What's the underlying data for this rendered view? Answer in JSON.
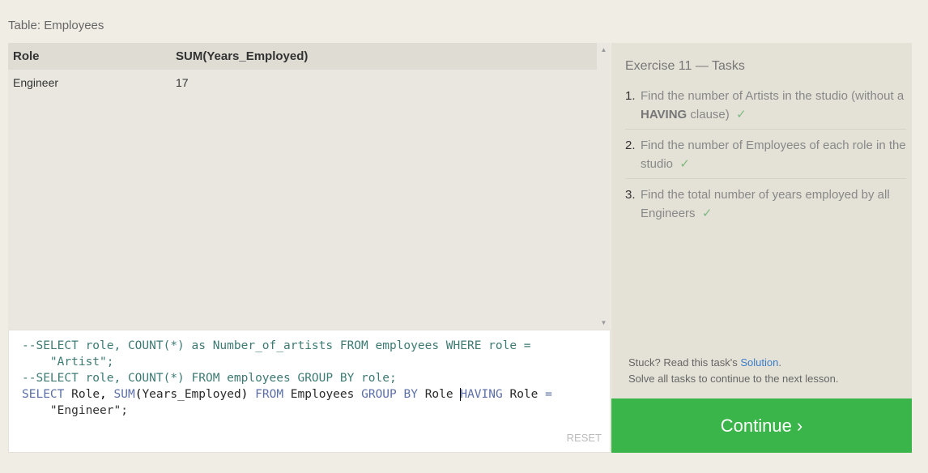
{
  "table_title": "Table: Employees",
  "results": {
    "columns": [
      "Role",
      "SUM(Years_Employed)"
    ],
    "rows": [
      [
        "Engineer",
        "17"
      ]
    ]
  },
  "editor": {
    "lines": [
      "--SELECT role, COUNT(*) as Number_of_artists FROM employees WHERE role =",
      "    \"Artist\";",
      "--SELECT role, COUNT(*) FROM employees GROUP BY role;",
      "SELECT Role, SUM(Years_Employed) FROM Employees GROUP BY Role HAVING Role =",
      "    \"Engineer\";"
    ],
    "reset_label": "RESET"
  },
  "tasks": {
    "title": "Exercise 11 — Tasks",
    "items": [
      {
        "num": "1.",
        "text_before": "Find the number of Artists in the studio (without a ",
        "bold": "HAVING",
        "text_after": " clause)",
        "check": "✓"
      },
      {
        "num": "2.",
        "text": "Find the number of Employees of each role in the studio",
        "check": "✓"
      },
      {
        "num": "3.",
        "text": "Find the total number of years employed by all Engineers",
        "check": "✓"
      }
    ],
    "stuck_text": "Stuck? Read this task's ",
    "solution_link": "Solution",
    "stuck_period": ".",
    "solve_text": "Solve all tasks to continue to the next lesson."
  },
  "continue_label": "Continue ›",
  "colors": {
    "continue_button": "#3ab54a",
    "solution_link": "#3c7dc9",
    "check": "#7fb97f"
  }
}
